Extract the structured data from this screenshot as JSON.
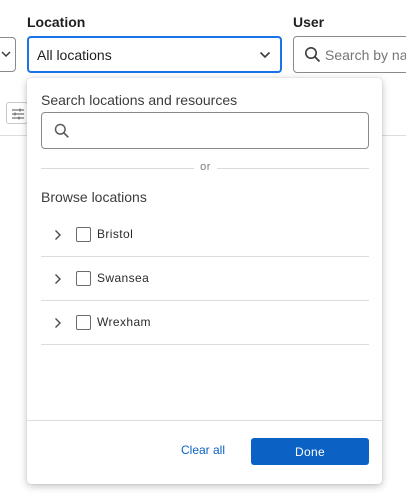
{
  "filters": {
    "location": {
      "label": "Location",
      "value": "All locations"
    },
    "user": {
      "label": "User",
      "placeholder": "Search by name"
    }
  },
  "location_dropdown": {
    "search_heading": "Search locations and resources",
    "search_value": "",
    "divider_text": "or",
    "browse_heading": "Browse locations",
    "locations": [
      {
        "name": "Bristol",
        "checked": false
      },
      {
        "name": "Swansea",
        "checked": false
      },
      {
        "name": "Wrexham",
        "checked": false
      }
    ],
    "clear_label": "Clear all",
    "done_label": "Done"
  },
  "colors": {
    "accent": "#1a73e8",
    "primary_button": "#0b62c4"
  }
}
